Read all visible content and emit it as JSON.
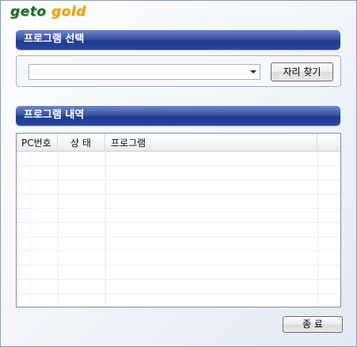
{
  "logo": {
    "part1": "geto",
    "part2": "gold"
  },
  "program_select": {
    "header": "프로그램 선택",
    "combo_value": "",
    "find_button": "자리 찾기"
  },
  "program_list": {
    "header": "프로그램 내역",
    "columns": [
      "PC번호",
      "상 태",
      "프로그램"
    ],
    "rows": []
  },
  "close_button": "종 료",
  "colors": {
    "header_bar": "#2a47a0",
    "logo_green": "#1f6a2c",
    "logo_gold": "#e4a21c"
  }
}
